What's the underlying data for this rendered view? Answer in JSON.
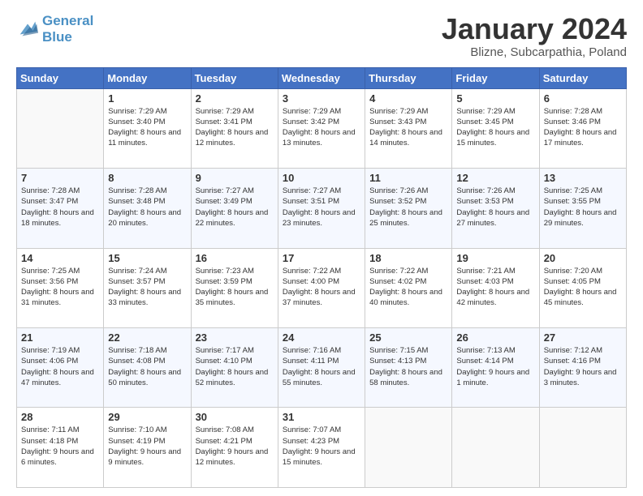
{
  "header": {
    "logo_line1": "General",
    "logo_line2": "Blue",
    "month": "January 2024",
    "location": "Blizne, Subcarpathia, Poland"
  },
  "days_of_week": [
    "Sunday",
    "Monday",
    "Tuesday",
    "Wednesday",
    "Thursday",
    "Friday",
    "Saturday"
  ],
  "weeks": [
    [
      {
        "day": "",
        "empty": true
      },
      {
        "day": "1",
        "sunrise": "Sunrise: 7:29 AM",
        "sunset": "Sunset: 3:40 PM",
        "daylight": "Daylight: 8 hours and 11 minutes."
      },
      {
        "day": "2",
        "sunrise": "Sunrise: 7:29 AM",
        "sunset": "Sunset: 3:41 PM",
        "daylight": "Daylight: 8 hours and 12 minutes."
      },
      {
        "day": "3",
        "sunrise": "Sunrise: 7:29 AM",
        "sunset": "Sunset: 3:42 PM",
        "daylight": "Daylight: 8 hours and 13 minutes."
      },
      {
        "day": "4",
        "sunrise": "Sunrise: 7:29 AM",
        "sunset": "Sunset: 3:43 PM",
        "daylight": "Daylight: 8 hours and 14 minutes."
      },
      {
        "day": "5",
        "sunrise": "Sunrise: 7:29 AM",
        "sunset": "Sunset: 3:45 PM",
        "daylight": "Daylight: 8 hours and 15 minutes."
      },
      {
        "day": "6",
        "sunrise": "Sunrise: 7:28 AM",
        "sunset": "Sunset: 3:46 PM",
        "daylight": "Daylight: 8 hours and 17 minutes."
      }
    ],
    [
      {
        "day": "7",
        "sunrise": "Sunrise: 7:28 AM",
        "sunset": "Sunset: 3:47 PM",
        "daylight": "Daylight: 8 hours and 18 minutes."
      },
      {
        "day": "8",
        "sunrise": "Sunrise: 7:28 AM",
        "sunset": "Sunset: 3:48 PM",
        "daylight": "Daylight: 8 hours and 20 minutes."
      },
      {
        "day": "9",
        "sunrise": "Sunrise: 7:27 AM",
        "sunset": "Sunset: 3:49 PM",
        "daylight": "Daylight: 8 hours and 22 minutes."
      },
      {
        "day": "10",
        "sunrise": "Sunrise: 7:27 AM",
        "sunset": "Sunset: 3:51 PM",
        "daylight": "Daylight: 8 hours and 23 minutes."
      },
      {
        "day": "11",
        "sunrise": "Sunrise: 7:26 AM",
        "sunset": "Sunset: 3:52 PM",
        "daylight": "Daylight: 8 hours and 25 minutes."
      },
      {
        "day": "12",
        "sunrise": "Sunrise: 7:26 AM",
        "sunset": "Sunset: 3:53 PM",
        "daylight": "Daylight: 8 hours and 27 minutes."
      },
      {
        "day": "13",
        "sunrise": "Sunrise: 7:25 AM",
        "sunset": "Sunset: 3:55 PM",
        "daylight": "Daylight: 8 hours and 29 minutes."
      }
    ],
    [
      {
        "day": "14",
        "sunrise": "Sunrise: 7:25 AM",
        "sunset": "Sunset: 3:56 PM",
        "daylight": "Daylight: 8 hours and 31 minutes."
      },
      {
        "day": "15",
        "sunrise": "Sunrise: 7:24 AM",
        "sunset": "Sunset: 3:57 PM",
        "daylight": "Daylight: 8 hours and 33 minutes."
      },
      {
        "day": "16",
        "sunrise": "Sunrise: 7:23 AM",
        "sunset": "Sunset: 3:59 PM",
        "daylight": "Daylight: 8 hours and 35 minutes."
      },
      {
        "day": "17",
        "sunrise": "Sunrise: 7:22 AM",
        "sunset": "Sunset: 4:00 PM",
        "daylight": "Daylight: 8 hours and 37 minutes."
      },
      {
        "day": "18",
        "sunrise": "Sunrise: 7:22 AM",
        "sunset": "Sunset: 4:02 PM",
        "daylight": "Daylight: 8 hours and 40 minutes."
      },
      {
        "day": "19",
        "sunrise": "Sunrise: 7:21 AM",
        "sunset": "Sunset: 4:03 PM",
        "daylight": "Daylight: 8 hours and 42 minutes."
      },
      {
        "day": "20",
        "sunrise": "Sunrise: 7:20 AM",
        "sunset": "Sunset: 4:05 PM",
        "daylight": "Daylight: 8 hours and 45 minutes."
      }
    ],
    [
      {
        "day": "21",
        "sunrise": "Sunrise: 7:19 AM",
        "sunset": "Sunset: 4:06 PM",
        "daylight": "Daylight: 8 hours and 47 minutes."
      },
      {
        "day": "22",
        "sunrise": "Sunrise: 7:18 AM",
        "sunset": "Sunset: 4:08 PM",
        "daylight": "Daylight: 8 hours and 50 minutes."
      },
      {
        "day": "23",
        "sunrise": "Sunrise: 7:17 AM",
        "sunset": "Sunset: 4:10 PM",
        "daylight": "Daylight: 8 hours and 52 minutes."
      },
      {
        "day": "24",
        "sunrise": "Sunrise: 7:16 AM",
        "sunset": "Sunset: 4:11 PM",
        "daylight": "Daylight: 8 hours and 55 minutes."
      },
      {
        "day": "25",
        "sunrise": "Sunrise: 7:15 AM",
        "sunset": "Sunset: 4:13 PM",
        "daylight": "Daylight: 8 hours and 58 minutes."
      },
      {
        "day": "26",
        "sunrise": "Sunrise: 7:13 AM",
        "sunset": "Sunset: 4:14 PM",
        "daylight": "Daylight: 9 hours and 1 minute."
      },
      {
        "day": "27",
        "sunrise": "Sunrise: 7:12 AM",
        "sunset": "Sunset: 4:16 PM",
        "daylight": "Daylight: 9 hours and 3 minutes."
      }
    ],
    [
      {
        "day": "28",
        "sunrise": "Sunrise: 7:11 AM",
        "sunset": "Sunset: 4:18 PM",
        "daylight": "Daylight: 9 hours and 6 minutes."
      },
      {
        "day": "29",
        "sunrise": "Sunrise: 7:10 AM",
        "sunset": "Sunset: 4:19 PM",
        "daylight": "Daylight: 9 hours and 9 minutes."
      },
      {
        "day": "30",
        "sunrise": "Sunrise: 7:08 AM",
        "sunset": "Sunset: 4:21 PM",
        "daylight": "Daylight: 9 hours and 12 minutes."
      },
      {
        "day": "31",
        "sunrise": "Sunrise: 7:07 AM",
        "sunset": "Sunset: 4:23 PM",
        "daylight": "Daylight: 9 hours and 15 minutes."
      },
      {
        "day": "",
        "empty": true
      },
      {
        "day": "",
        "empty": true
      },
      {
        "day": "",
        "empty": true
      }
    ]
  ]
}
